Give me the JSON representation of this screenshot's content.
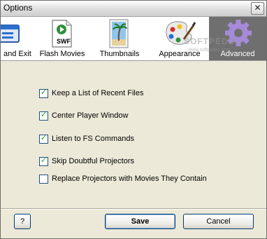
{
  "window": {
    "title": "Options",
    "close_glyph": "✕"
  },
  "toolbar": {
    "items": [
      {
        "label": "and Exit",
        "icon": "save-exit-icon"
      },
      {
        "label": "Flash Movies",
        "icon": "swf-file-icon",
        "icon_text": "SWF"
      },
      {
        "label": "Thumbnails",
        "icon": "thumbnail-palm-icon"
      },
      {
        "label": "Appearance",
        "icon": "palette-icon"
      },
      {
        "label": "Advanced",
        "icon": "gear-icon",
        "active": true
      }
    ]
  },
  "watermark": {
    "text": "SOFTPEDIA",
    "url": "www.softpedia.com"
  },
  "options": [
    {
      "label": "Keep a List of Recent Files",
      "checked": true
    },
    {
      "label": "Center Player Window",
      "checked": true
    },
    {
      "label": "Listen to FS Commands",
      "checked": true
    },
    {
      "label": "Skip Doubtful Projectors",
      "checked": true
    },
    {
      "label": "Replace Projectors with Movies They Contain",
      "checked": false
    }
  ],
  "buttons": {
    "help": "?",
    "save": "Save",
    "cancel": "Cancel"
  },
  "check_glyph": "✓",
  "colors": {
    "active_tab_bg": "#6f6f6f",
    "checkmark": "#21a121",
    "checkbox_border": "#1c5180"
  }
}
